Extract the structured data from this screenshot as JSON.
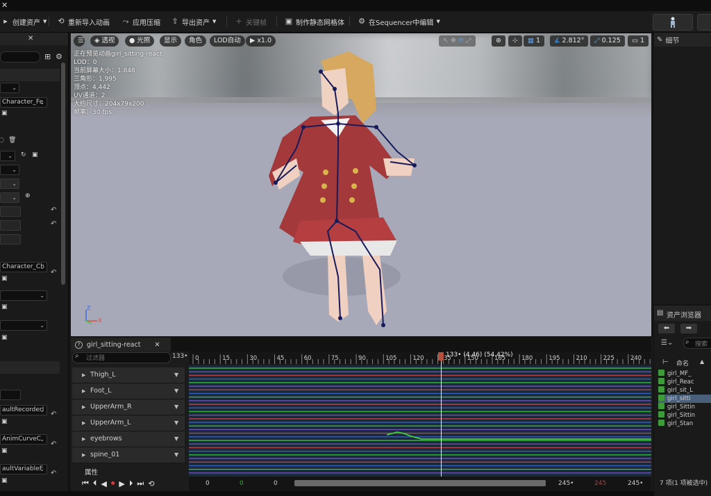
{
  "toolbar": {
    "items": [
      "创建资产",
      "重新导入动画",
      "应用压缩",
      "导出资产",
      "关键帧",
      "制作静态网格体",
      "在Sequencer中编辑"
    ]
  },
  "left_panel": {
    "combo1": "Character_Fe",
    "combo2": "Character_Ch",
    "combo3": "aultRecorderI",
    "combo4": "AnimCurveC",
    "combo5": "aultVariableF"
  },
  "viewport": {
    "buttons": {
      "perspective": "透视",
      "lit": "光照",
      "show": "显示",
      "character": "角色",
      "lod": "LOD自动",
      "speed": "x1.0"
    },
    "right_controls": {
      "grid": "1",
      "angle": "2.812°",
      "scale": "0.125",
      "camera": "1"
    },
    "stats": [
      "正在预览动画girl_sitting-react",
      "LOD：0",
      "当前屏幕大小：1.848",
      "三角形：1,995",
      "顶点：4,442",
      "UV通道：2",
      "大约尺寸：204x79x200",
      "帧率：30 fps"
    ]
  },
  "timeline": {
    "tab": "girl_sitting-react",
    "filter_placeholder": "过滤器",
    "frame_field": "133•",
    "playhead_label": "133• (4.46) (54.42%)",
    "ruler_ticks": [
      "0",
      "15",
      "30",
      "45",
      "60",
      "75",
      "90",
      "105",
      "120",
      "135",
      "150",
      "165",
      "180",
      "195",
      "210",
      "225",
      "240"
    ],
    "tracks": [
      "Thigh_L",
      "Foot_L",
      "UpperArm_R",
      "UpperArm_L",
      "eyebrows",
      "spine_01"
    ],
    "properties_label": "属性",
    "bottom_nums": {
      "a": "0",
      "b": "0",
      "c": "0",
      "d": "245•",
      "e": "245",
      "f": "245•"
    },
    "colors": {
      "curve_bg": "#1a2a3c",
      "green": "#3fcf3f",
      "purple": "#7a58c8",
      "red": "#d04c4c",
      "blue": "#3a6ac8"
    }
  },
  "details_panel": {
    "title": "细节"
  },
  "content_browser": {
    "title": "资产浏览器",
    "search_placeholder": "搜索",
    "column": "命名",
    "assets": [
      "girl_MF_",
      "girl_Reac",
      "girl_sit_L",
      "girl_sitti",
      "girl_Sittin",
      "girl_Sittin",
      "girl_Stan"
    ],
    "selected_index": 3,
    "footer": "7 项(1 项被选中)"
  }
}
